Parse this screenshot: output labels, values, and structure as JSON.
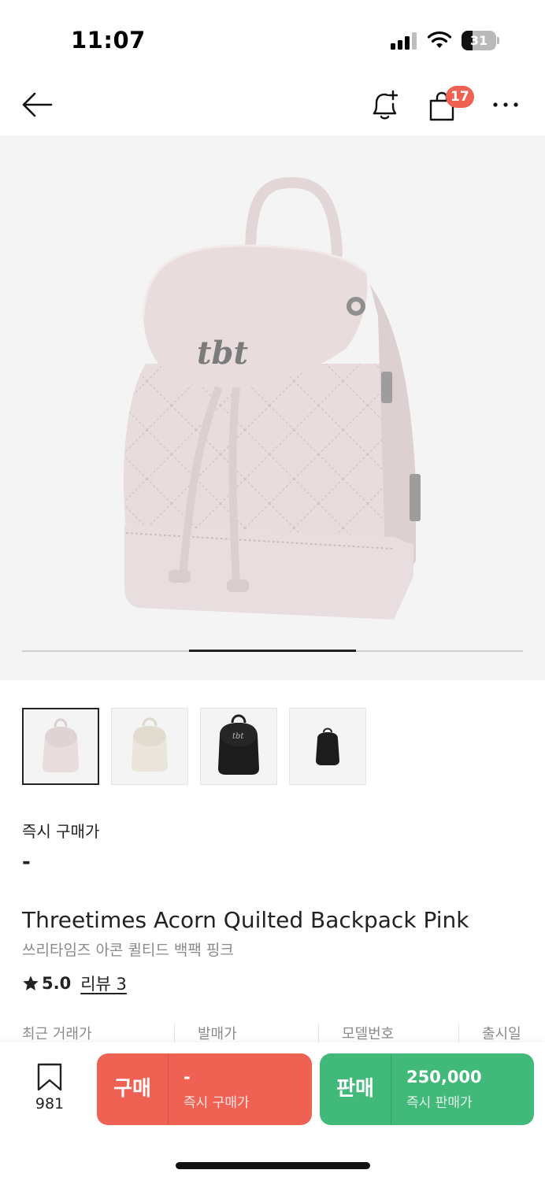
{
  "status_bar": {
    "time": "11:07",
    "battery_level": "31",
    "battery_fraction": 0.31
  },
  "nav": {
    "cart_count": "17",
    "icons": [
      "back-arrow-icon",
      "bell-plus-icon",
      "shopping-bag-icon",
      "more-icon"
    ]
  },
  "gallery": {
    "image_index": 2,
    "image_count": 3,
    "thumbnails": [
      {
        "name": "pink",
        "color": "#e8dcdd",
        "selected": true
      },
      {
        "name": "ivory",
        "color": "#e9e4da",
        "selected": false
      },
      {
        "name": "black-large",
        "color": "#1c1c1c",
        "selected": false
      },
      {
        "name": "black-small",
        "color": "#1c1c1c",
        "selected": false
      }
    ]
  },
  "price": {
    "instant_buy_label": "즉시 구매가",
    "instant_buy_value": "-"
  },
  "product": {
    "name_en": "Threetimes Acorn Quilted Backpack Pink",
    "name_ko": "쓰리타임즈 아콘 퀼티드 백팩 핑크",
    "rating": "5.0",
    "review_label": "리뷰 3"
  },
  "info": {
    "columns": [
      "최근 거래가",
      "발매가",
      "모델번호",
      "출시일"
    ]
  },
  "bottom_bar": {
    "wish_count": "981",
    "buy": {
      "label": "구매",
      "price": "-",
      "sub": "즉시 구매가"
    },
    "sell": {
      "label": "판매",
      "price": "250,000",
      "sub": "즉시 판매가"
    }
  },
  "colors": {
    "buy": "#ef6253",
    "sell": "#41b979",
    "badge": "#ef6253",
    "bag_pink": "#e8dcdd"
  }
}
